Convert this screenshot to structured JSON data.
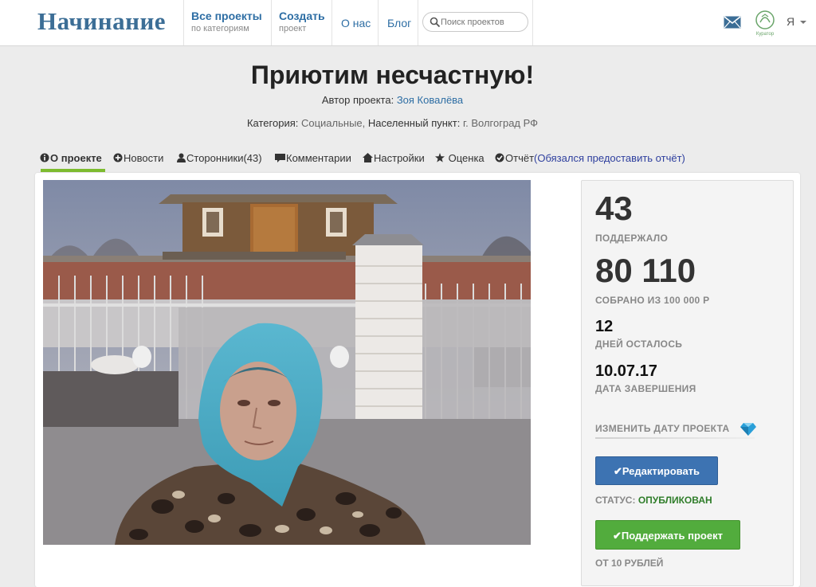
{
  "header": {
    "logo": "Начинание",
    "nav": [
      {
        "label": "Все проекты",
        "sub": "по категориям"
      },
      {
        "label": "Создать",
        "sub": "проект"
      },
      {
        "label": "О нас"
      },
      {
        "label": "Блог"
      }
    ],
    "search_placeholder": "Поиск проектов",
    "partner_logo_text": "Куратор",
    "user_label": "Я"
  },
  "project": {
    "title": "Приютим несчастную!",
    "author_label": "Автор проекта:",
    "author_name": "Зоя Ковалёва",
    "category_label": "Категория:",
    "category_value": "Социальные,",
    "location_label": "Населенный пункт:",
    "location_value": "г. Волгоград РФ"
  },
  "tabs": [
    {
      "label": "О проекте",
      "icon": "info-icon",
      "active": true
    },
    {
      "label": "Новости",
      "icon": "plus-circle-icon"
    },
    {
      "label": "Сторонники(43)",
      "icon": "user-icon"
    },
    {
      "label": "Комментарии",
      "icon": "comment-icon"
    },
    {
      "label": "Настройки",
      "icon": "home-icon"
    },
    {
      "label": "Оценка",
      "icon": "star-icon"
    },
    {
      "label": "Отчёт",
      "link": "(Обязался предоставить отчёт)",
      "icon": "check-circle-icon"
    }
  ],
  "stats": {
    "supporters": "43",
    "supporters_label": "ПОДДЕРЖАЛО",
    "collected": "80 110",
    "collected_label": "СОБРАНО ИЗ 100 000 Р",
    "days_left": "12",
    "days_left_label": "ДНЕЙ ОСТАЛОСЬ",
    "end_date": "10.07.17",
    "end_date_label": "ДАТА ЗАВЕРШЕНИЯ",
    "change_date_label": "ИЗМЕНИТЬ ДАТУ ПРОЕКТА",
    "edit_button": "✔Редактировать",
    "status_label": "СТАТУС:",
    "status_value": "ОПУБЛИКОВАН",
    "support_button": "✔Поддержать проект",
    "min_amount": "ОТ 10 РУБЛЕЙ"
  },
  "colors": {
    "brand": "#3c6e96",
    "link": "#2e6ea4",
    "tab_active": "#7dbc2f",
    "edit_button": "#3d73b2",
    "support_button": "#52ac3d",
    "status_ok": "#2f7d2a"
  }
}
